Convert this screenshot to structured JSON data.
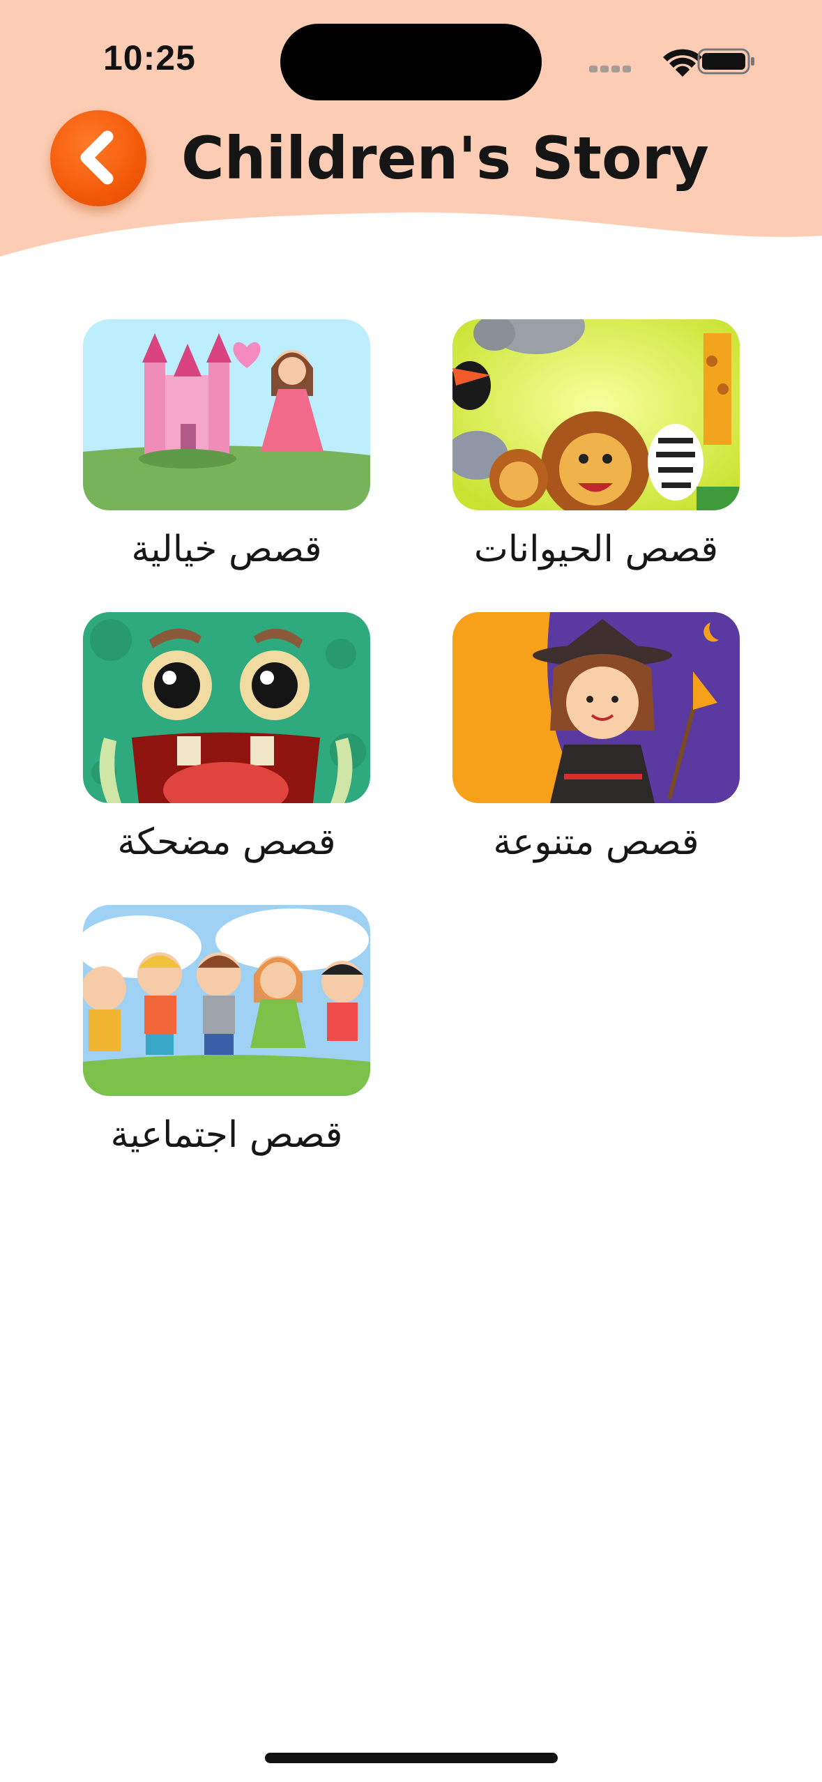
{
  "status_bar": {
    "time": "10:25"
  },
  "header": {
    "title": "Children's Story",
    "bg_color": "#fccdb4",
    "back_button_color": "#f25a09"
  },
  "categories": [
    {
      "label": "قصص الحيوانات",
      "image": "animals-illustration"
    },
    {
      "label": "قصص خيالية",
      "image": "fantasy-castle-princess-illustration"
    },
    {
      "label": "قصص متنوعة",
      "image": "witch-girl-illustration"
    },
    {
      "label": "قصص مضحكة",
      "image": "green-monster-illustration"
    },
    {
      "label": "قصص اجتماعية",
      "image": "children-holding-hands-illustration"
    }
  ]
}
